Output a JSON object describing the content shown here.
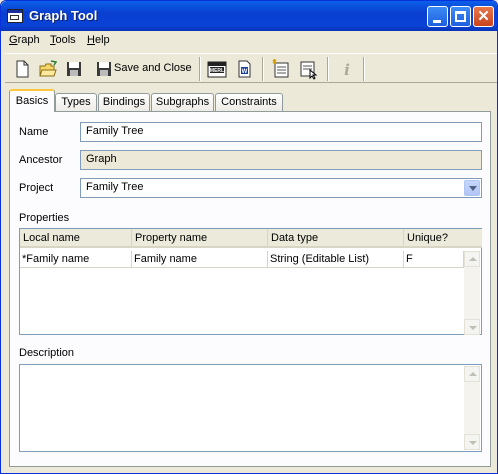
{
  "window": {
    "title": "Graph Tool"
  },
  "menu": [
    "Graph",
    "Tools",
    "Help"
  ],
  "toolbar": {
    "save_close_label": "Save and Close"
  },
  "tabs": [
    "Basics",
    "Types",
    "Bindings",
    "Subgraphs",
    "Constraints"
  ],
  "form": {
    "name_label": "Name",
    "name_value": "Family Tree",
    "ancestor_label": "Ancestor",
    "ancestor_value": "Graph",
    "project_label": "Project",
    "project_value": "Family Tree",
    "properties_label": "Properties",
    "description_label": "Description"
  },
  "properties": {
    "columns": [
      "Local name",
      "Property name",
      "Data type",
      "Unique?"
    ],
    "rows": [
      [
        "*Family name",
        "Family name",
        "String (Editable List)",
        "F"
      ]
    ]
  },
  "colors": {
    "title_bar": "#0a43d8",
    "accent": "#ffc83c"
  }
}
